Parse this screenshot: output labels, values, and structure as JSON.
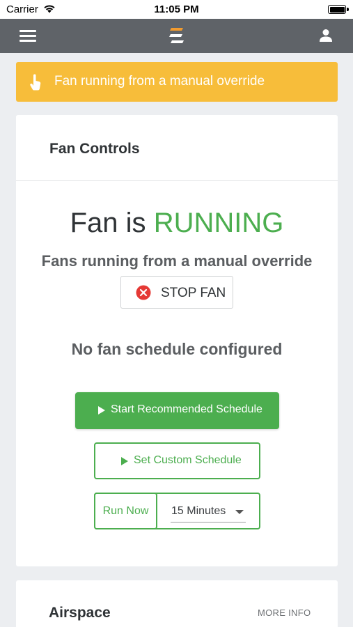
{
  "status_bar": {
    "carrier": "Carrier",
    "time": "11:05 PM"
  },
  "nav": {
    "menu_icon": "hamburger-menu-icon",
    "logo_icon": "brand-logo-icon",
    "user_icon": "user-icon"
  },
  "alert": {
    "icon": "hand-pointer-icon",
    "text": "Fan running from a manual override",
    "color": "#f7bd3a"
  },
  "fan_controls": {
    "title": "Fan Controls",
    "status_prefix": "Fan is",
    "status_state": "RUNNING",
    "state_color": "#4cae4f",
    "subtitle": "Fans running from a manual override",
    "stop_button_label": "STOP FAN",
    "no_schedule_text": "No fan schedule configured",
    "recommended_button_label": "Start Recommended Schedule",
    "custom_button_label": "Set Custom Schedule",
    "run_now_label": "Run Now",
    "duration_selected": "15 Minutes"
  },
  "airspace": {
    "title": "Airspace",
    "more_info_label": "MORE INFO"
  }
}
